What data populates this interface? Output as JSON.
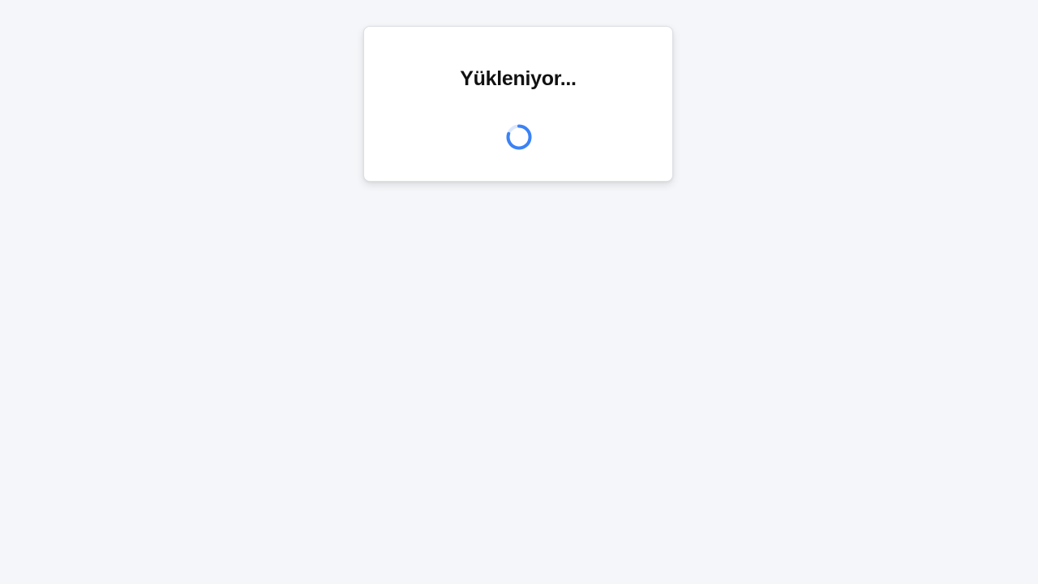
{
  "loading_card": {
    "title": "Yükleniyor...",
    "spinner_icon": "loading-spinner-icon",
    "spinner_color": "#3b82f6"
  },
  "colors": {
    "background": "#f4f6f9",
    "card": "#ffffff",
    "accent": "#3b82f6"
  }
}
